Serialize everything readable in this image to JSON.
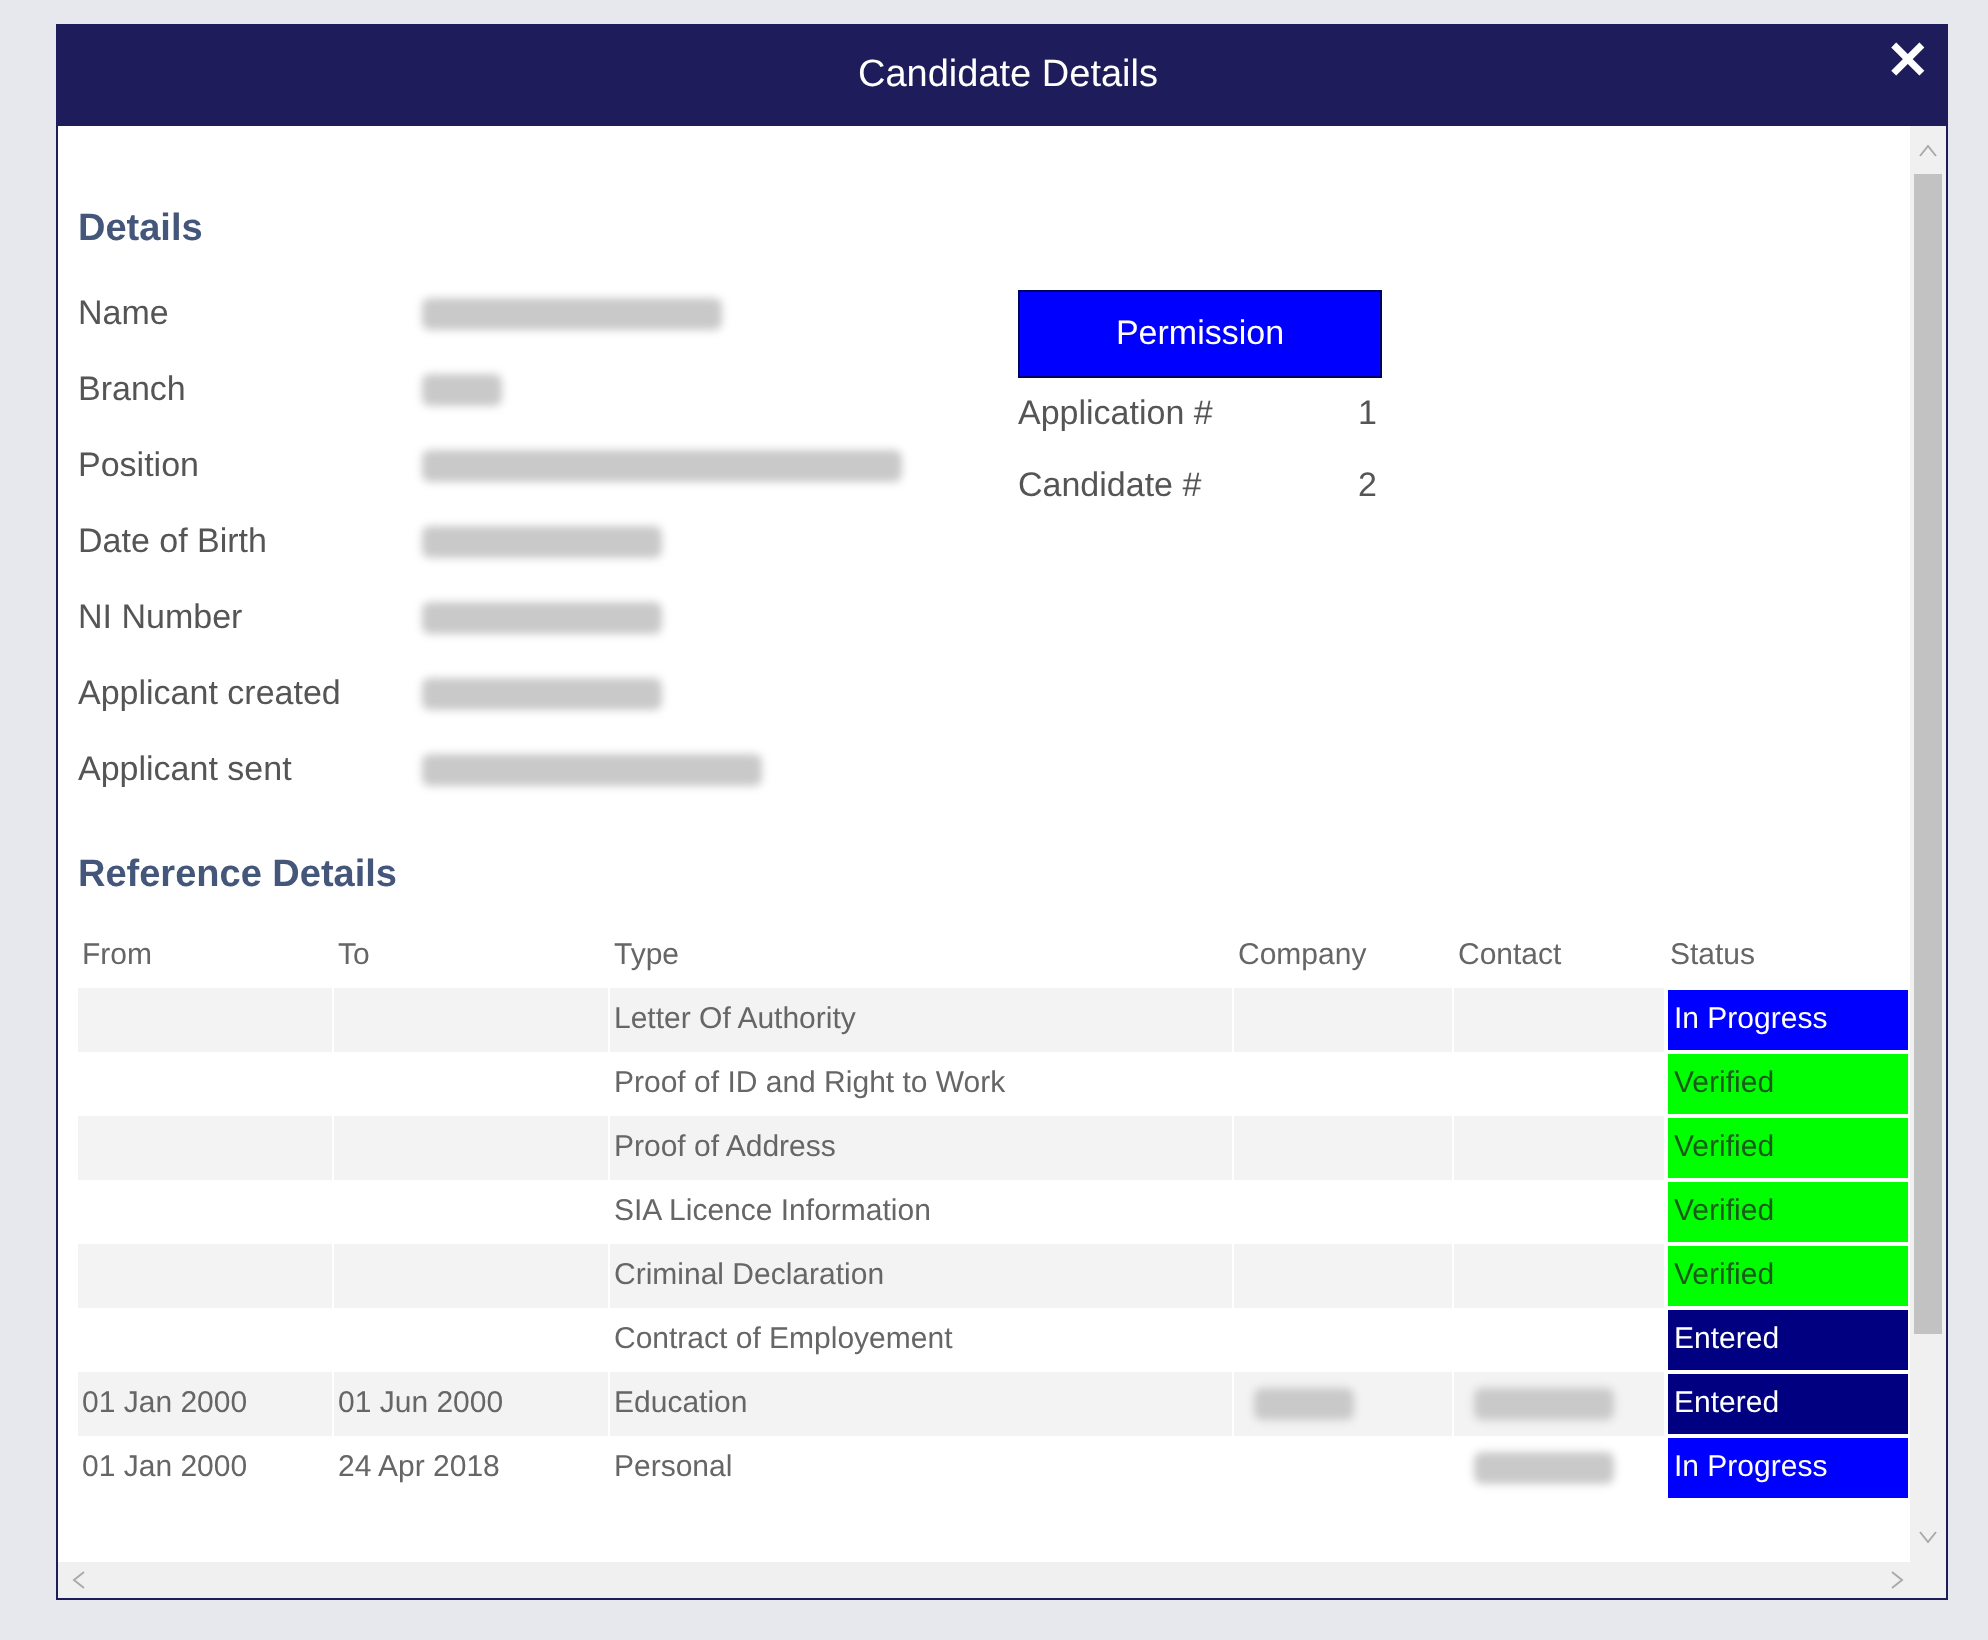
{
  "dialog": {
    "title": "Candidate Details",
    "close": "✕"
  },
  "details": {
    "heading": "Details",
    "fields": [
      {
        "label": "Name",
        "redacted": true
      },
      {
        "label": "Branch",
        "redacted": true
      },
      {
        "label": "Position",
        "redacted": true
      },
      {
        "label": "Date of Birth",
        "redacted": true
      },
      {
        "label": "NI Number",
        "redacted": true
      },
      {
        "label": "Applicant created",
        "redacted": true
      },
      {
        "label": "Applicant sent",
        "redacted": true
      }
    ]
  },
  "permission_button": "Permission",
  "numbers": [
    {
      "label": "Application #",
      "value": "1"
    },
    {
      "label": "Candidate #",
      "value": "2"
    }
  ],
  "references": {
    "heading": "Reference Details",
    "columns": [
      "From",
      "To",
      "Type",
      "Company",
      "Contact",
      "Status"
    ],
    "rows": [
      {
        "type": "Letter Of Authority",
        "status": "In Progress",
        "color": "#0000ff"
      },
      {
        "type": "Proof of ID and Right to Work",
        "status": "Verified",
        "color": "#00ff00"
      },
      {
        "type": "Proof of Address",
        "status": "Verified",
        "color": "#00ff00"
      },
      {
        "type": "SIA Licence Information",
        "status": "Verified",
        "color": "#00ff00"
      },
      {
        "type": "Criminal Declaration",
        "status": "Verified",
        "color": "#00ff00"
      },
      {
        "type": "Contract of Employement",
        "status": "Entered",
        "color": "#000080"
      },
      {
        "from": "01 Jan 2000",
        "to": "01 Jun 2000",
        "type": "Education",
        "company_redacted": true,
        "contact_redacted": true,
        "status": "Entered",
        "color": "#000080"
      },
      {
        "from": "01 Jan 2000",
        "to": "24 Apr 2018",
        "type": "Personal",
        "contact_redacted": true,
        "status": "In Progress",
        "color": "#0000ff"
      }
    ]
  }
}
